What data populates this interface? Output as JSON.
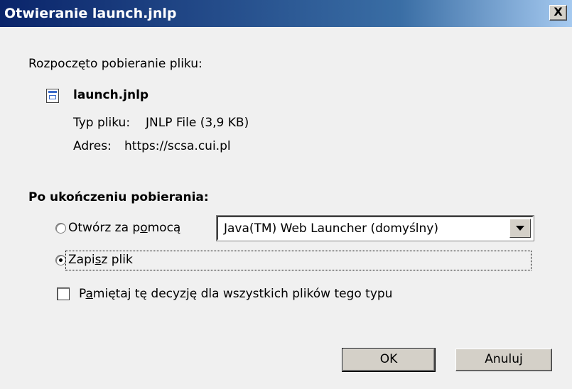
{
  "window": {
    "title": "Otwieranie launch.jnlp",
    "close_label": "X"
  },
  "intro": "Rozpoczęto pobieranie pliku:",
  "file": {
    "name": "launch.jnlp",
    "type_label": "Typ pliku:",
    "type_value": "JNLP File (3,9 KB)",
    "address_label": "Adres:",
    "address_value": "https://scsa.cui.pl"
  },
  "section_heading": "Po ukończeniu pobierania:",
  "options": {
    "open_with": {
      "label_pre": "Otwórz za p",
      "label_accel": "o",
      "label_post": "mocą",
      "checked": false,
      "app_selected": "Java(TM) Web Launcher (domyślny)"
    },
    "save": {
      "label_pre": "Zapi",
      "label_accel": "s",
      "label_post": "z plik",
      "checked": true
    }
  },
  "remember": {
    "label_pre": "P",
    "label_accel": "a",
    "label_post": "miętaj tę decyzję dla wszystkich plików tego typu",
    "checked": false
  },
  "buttons": {
    "ok": "OK",
    "cancel": "Anuluj"
  }
}
